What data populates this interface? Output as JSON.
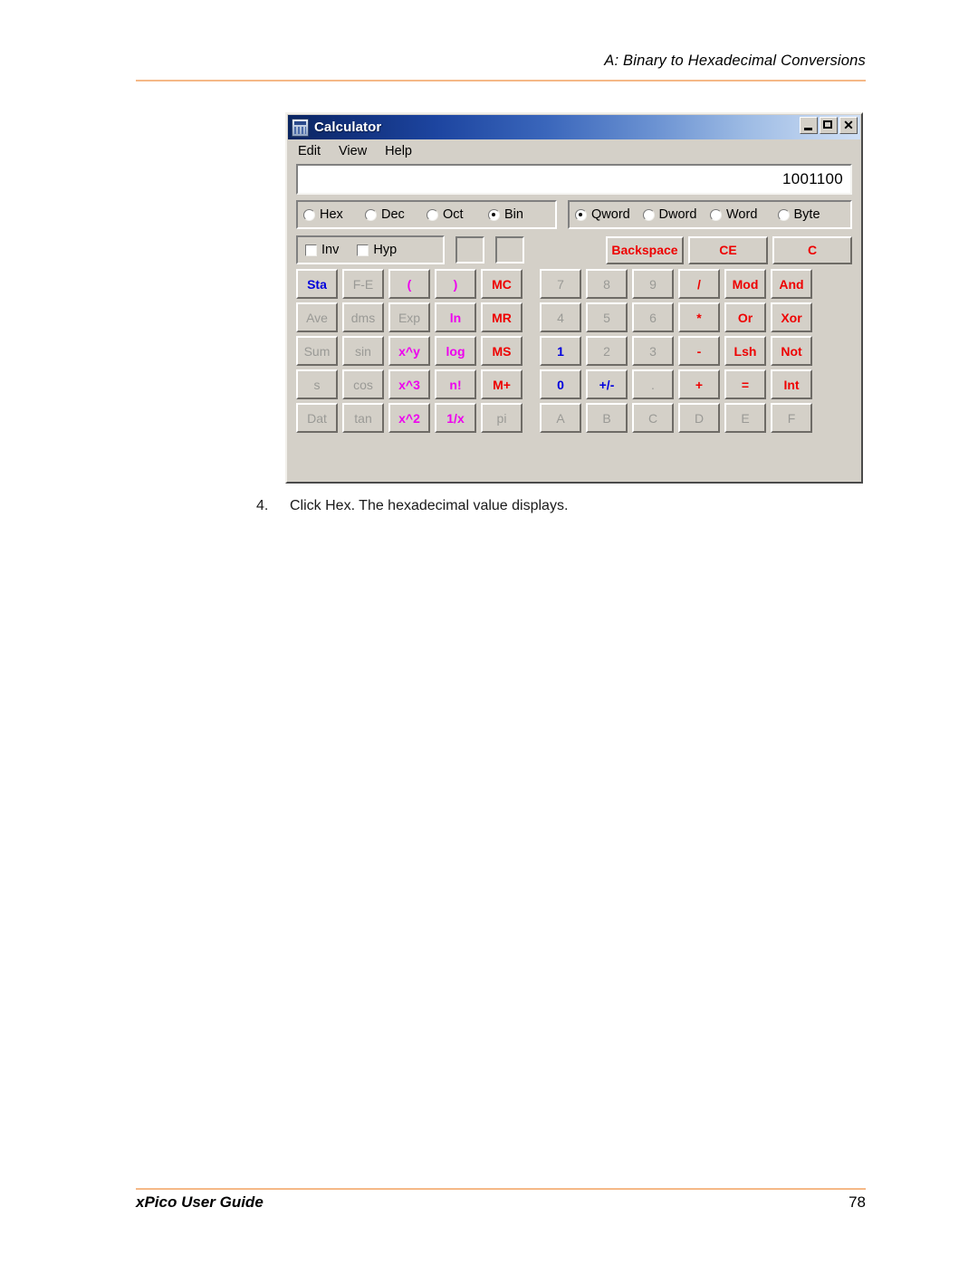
{
  "page": {
    "header_title": "A: Binary to Hexadecimal Conversions",
    "footer_left": "xPico User Guide",
    "footer_page": "78",
    "accent_color": "#f5b887"
  },
  "step": {
    "number": "4.",
    "text": "Click Hex. The hexadecimal value displays."
  },
  "calculator": {
    "window_title": "Calculator",
    "title_icon": "calculator-icon",
    "window_buttons": {
      "minimize": "minimize-icon",
      "maximize": "maximize-icon",
      "close": "✕"
    },
    "menu": [
      "Edit",
      "View",
      "Help"
    ],
    "display_value": "1001100",
    "base_group": [
      {
        "label": "Hex",
        "selected": false
      },
      {
        "label": "Dec",
        "selected": false
      },
      {
        "label": "Oct",
        "selected": false
      },
      {
        "label": "Bin",
        "selected": true
      }
    ],
    "word_group": [
      {
        "label": "Qword",
        "selected": true
      },
      {
        "label": "Dword",
        "selected": false
      },
      {
        "label": "Word",
        "selected": false
      },
      {
        "label": "Byte",
        "selected": false
      }
    ],
    "modifiers": [
      {
        "label": "Inv",
        "checked": false
      },
      {
        "label": "Hyp",
        "checked": false
      }
    ],
    "indicator_boxes": [
      "",
      ""
    ],
    "edit_buttons": [
      {
        "label": "Backspace",
        "color": "red"
      },
      {
        "label": "CE",
        "color": "red"
      },
      {
        "label": "C",
        "color": "red"
      }
    ],
    "keypad_rows": [
      [
        {
          "label": "Sta",
          "color": "blue",
          "enabled": true
        },
        {
          "label": "F-E",
          "color": "gray",
          "enabled": false
        },
        {
          "label": "(",
          "color": "magenta",
          "enabled": true
        },
        {
          "label": ")",
          "color": "magenta",
          "enabled": true
        },
        {
          "label": "MC",
          "color": "red",
          "enabled": true
        },
        {
          "gap": true
        },
        {
          "label": "7",
          "color": "gray",
          "enabled": false
        },
        {
          "label": "8",
          "color": "gray",
          "enabled": false
        },
        {
          "label": "9",
          "color": "gray",
          "enabled": false
        },
        {
          "label": "/",
          "color": "red",
          "enabled": true
        },
        {
          "label": "Mod",
          "color": "red",
          "enabled": true
        },
        {
          "label": "And",
          "color": "red",
          "enabled": true
        }
      ],
      [
        {
          "label": "Ave",
          "color": "gray",
          "enabled": false
        },
        {
          "label": "dms",
          "color": "gray",
          "enabled": false
        },
        {
          "label": "Exp",
          "color": "gray",
          "enabled": false
        },
        {
          "label": "ln",
          "color": "magenta",
          "enabled": true
        },
        {
          "label": "MR",
          "color": "red",
          "enabled": true
        },
        {
          "gap": true
        },
        {
          "label": "4",
          "color": "gray",
          "enabled": false
        },
        {
          "label": "5",
          "color": "gray",
          "enabled": false
        },
        {
          "label": "6",
          "color": "gray",
          "enabled": false
        },
        {
          "label": "*",
          "color": "red",
          "enabled": true
        },
        {
          "label": "Or",
          "color": "red",
          "enabled": true
        },
        {
          "label": "Xor",
          "color": "red",
          "enabled": true
        }
      ],
      [
        {
          "label": "Sum",
          "color": "gray",
          "enabled": false
        },
        {
          "label": "sin",
          "color": "gray",
          "enabled": false
        },
        {
          "label": "x^y",
          "color": "magenta",
          "enabled": true
        },
        {
          "label": "log",
          "color": "magenta",
          "enabled": true
        },
        {
          "label": "MS",
          "color": "red",
          "enabled": true
        },
        {
          "gap": true
        },
        {
          "label": "1",
          "color": "blue",
          "enabled": true
        },
        {
          "label": "2",
          "color": "gray",
          "enabled": false
        },
        {
          "label": "3",
          "color": "gray",
          "enabled": false
        },
        {
          "label": "-",
          "color": "red",
          "enabled": true
        },
        {
          "label": "Lsh",
          "color": "red",
          "enabled": true
        },
        {
          "label": "Not",
          "color": "red",
          "enabled": true
        }
      ],
      [
        {
          "label": "s",
          "color": "gray",
          "enabled": false
        },
        {
          "label": "cos",
          "color": "gray",
          "enabled": false
        },
        {
          "label": "x^3",
          "color": "magenta",
          "enabled": true
        },
        {
          "label": "n!",
          "color": "magenta",
          "enabled": true
        },
        {
          "label": "M+",
          "color": "red",
          "enabled": true
        },
        {
          "gap": true
        },
        {
          "label": "0",
          "color": "blue",
          "enabled": true
        },
        {
          "label": "+/-",
          "color": "blue",
          "enabled": true
        },
        {
          "label": ".",
          "color": "gray",
          "enabled": false
        },
        {
          "label": "+",
          "color": "red",
          "enabled": true
        },
        {
          "label": "=",
          "color": "red",
          "enabled": true
        },
        {
          "label": "Int",
          "color": "red",
          "enabled": true
        }
      ],
      [
        {
          "label": "Dat",
          "color": "gray",
          "enabled": false
        },
        {
          "label": "tan",
          "color": "gray",
          "enabled": false
        },
        {
          "label": "x^2",
          "color": "magenta",
          "enabled": true
        },
        {
          "label": "1/x",
          "color": "magenta",
          "enabled": true
        },
        {
          "label": "pi",
          "color": "gray",
          "enabled": false
        },
        {
          "gap": true
        },
        {
          "label": "A",
          "color": "gray",
          "enabled": false
        },
        {
          "label": "B",
          "color": "gray",
          "enabled": false
        },
        {
          "label": "C",
          "color": "gray",
          "enabled": false
        },
        {
          "label": "D",
          "color": "gray",
          "enabled": false
        },
        {
          "label": "E",
          "color": "gray",
          "enabled": false
        },
        {
          "label": "F",
          "color": "gray",
          "enabled": false
        }
      ]
    ]
  }
}
